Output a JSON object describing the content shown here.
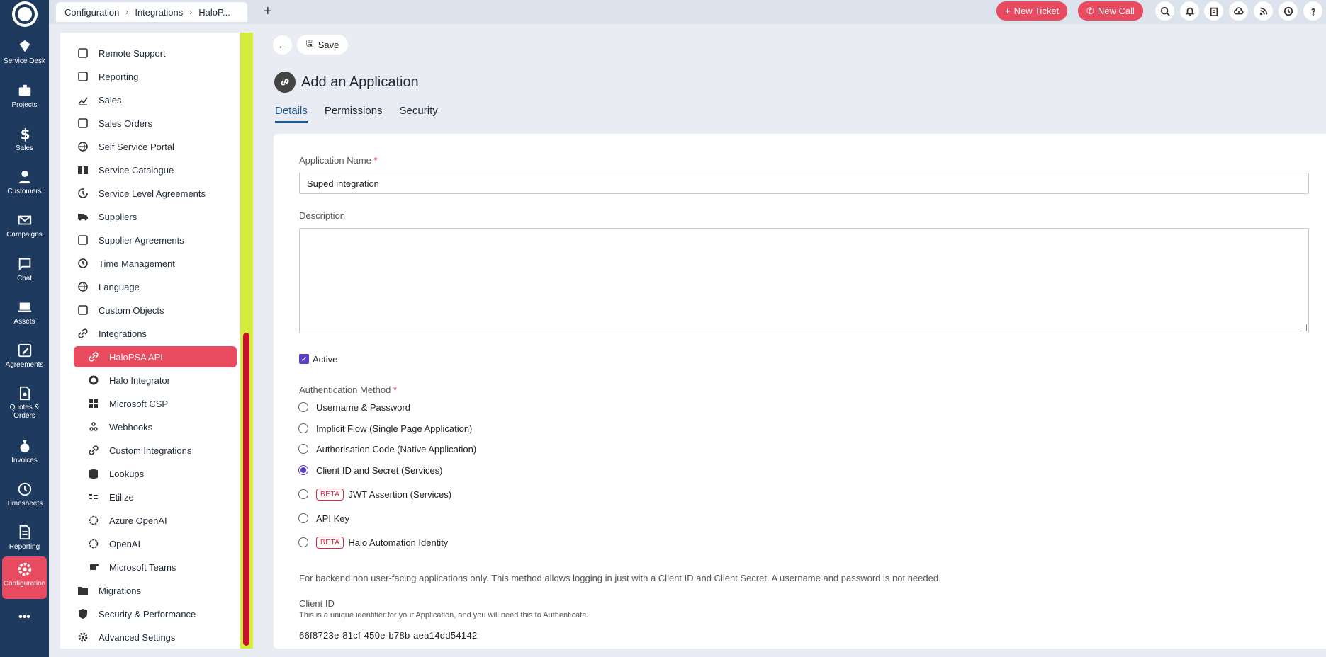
{
  "rail": [
    {
      "label": "Service Desk",
      "icon": "ticket-icon"
    },
    {
      "label": "Projects",
      "icon": "briefcase-icon"
    },
    {
      "label": "Sales",
      "icon": "dollar-icon"
    },
    {
      "label": "Customers",
      "icon": "person-icon"
    },
    {
      "label": "Campaigns",
      "icon": "mail-icon"
    },
    {
      "label": "Chat",
      "icon": "chat-icon"
    },
    {
      "label": "Assets",
      "icon": "laptop-icon"
    },
    {
      "label": "Agreements",
      "icon": "pen-icon"
    },
    {
      "label": "Quotes & Orders",
      "icon": "document-money-icon"
    },
    {
      "label": "Invoices",
      "icon": "money-bag-icon"
    },
    {
      "label": "Timesheets",
      "icon": "clock-icon"
    },
    {
      "label": "Reporting",
      "icon": "report-icon"
    },
    {
      "label": "Configuration",
      "icon": "gear-icon"
    },
    {
      "label": "•••",
      "icon": "more-icon"
    }
  ],
  "topbar": {
    "breadcrumb": [
      "Configuration",
      "Integrations",
      "HaloP..."
    ],
    "new_ticket": "New Ticket",
    "new_call": "New Call"
  },
  "config_menu": [
    {
      "label": "Remote Support",
      "icon": "remote-icon"
    },
    {
      "label": "Reporting",
      "icon": "report-icon"
    },
    {
      "label": "Sales",
      "icon": "chart-icon"
    },
    {
      "label": "Sales Orders",
      "icon": "sales-orders-icon"
    },
    {
      "label": "Self Service Portal",
      "icon": "globe-icon"
    },
    {
      "label": "Service Catalogue",
      "icon": "book-icon"
    },
    {
      "label": "Service Level Agreements",
      "icon": "timer-icon"
    },
    {
      "label": "Suppliers",
      "icon": "truck-icon"
    },
    {
      "label": "Supplier Agreements",
      "icon": "pen-icon"
    },
    {
      "label": "Time Management",
      "icon": "clock-icon"
    },
    {
      "label": "Language",
      "icon": "globe-icon"
    },
    {
      "label": "Custom Objects",
      "icon": "object-icon"
    },
    {
      "label": "Integrations",
      "icon": "link-icon"
    },
    {
      "label": "HaloPSA API",
      "icon": "link-icon",
      "sub": true,
      "selected": true
    },
    {
      "label": "Halo Integrator",
      "icon": "halo-icon",
      "sub": true
    },
    {
      "label": "Microsoft CSP",
      "icon": "windows-icon",
      "sub": true
    },
    {
      "label": "Webhooks",
      "icon": "webhook-icon",
      "sub": true
    },
    {
      "label": "Custom Integrations",
      "icon": "link-icon",
      "sub": true
    },
    {
      "label": "Lookups",
      "icon": "database-icon",
      "sub": true
    },
    {
      "label": "Etilize",
      "icon": "etilize-icon",
      "sub": true
    },
    {
      "label": "Azure OpenAI",
      "icon": "openai-icon",
      "sub": true
    },
    {
      "label": "OpenAI",
      "icon": "openai-icon",
      "sub": true
    },
    {
      "label": "Microsoft Teams",
      "icon": "teams-icon",
      "sub": true
    },
    {
      "label": "Migrations",
      "icon": "folder-icon"
    },
    {
      "label": "Security & Performance",
      "icon": "shield-icon"
    },
    {
      "label": "Advanced Settings",
      "icon": "gear-icon"
    }
  ],
  "toolbar": {
    "save": "Save"
  },
  "page": {
    "title": "Add an Application",
    "tabs": [
      "Details",
      "Permissions",
      "Security"
    ],
    "active_tab": "Details"
  },
  "form": {
    "app_name_label": "Application Name",
    "required_mark": "*",
    "app_name_value": "Suped integration",
    "description_label": "Description",
    "description_value": "",
    "active_label": "Active",
    "active_checked": true,
    "auth_label": "Authentication Method",
    "auth_options": [
      {
        "label": "Username & Password",
        "beta": false,
        "selected": false
      },
      {
        "label": "Implicit Flow (Single Page Application)",
        "beta": false,
        "selected": false
      },
      {
        "label": "Authorisation Code (Native Application)",
        "beta": false,
        "selected": false
      },
      {
        "label": "Client ID and Secret (Services)",
        "beta": false,
        "selected": true
      },
      {
        "label": "JWT Assertion (Services)",
        "beta": true,
        "selected": false
      },
      {
        "label": "API Key",
        "beta": false,
        "selected": false
      },
      {
        "label": "Halo Automation Identity",
        "beta": true,
        "selected": false
      }
    ],
    "beta_label": "BETA",
    "auth_note": "For backend non user-facing applications only. This method allows logging in just with a Client ID and Client Secret. A username and password is not needed.",
    "client_id_label": "Client ID",
    "client_id_help": "This is a unique identifier for your Application, and you will need this to Authenticate.",
    "client_id_value": "66f8723e-81cf-450e-b78b-aea14dd54142"
  },
  "colors": {
    "accent": "#e84a5f",
    "rail": "#1e3a5f",
    "radio": "#5c3ec4",
    "tab": "#1e5a9e"
  }
}
